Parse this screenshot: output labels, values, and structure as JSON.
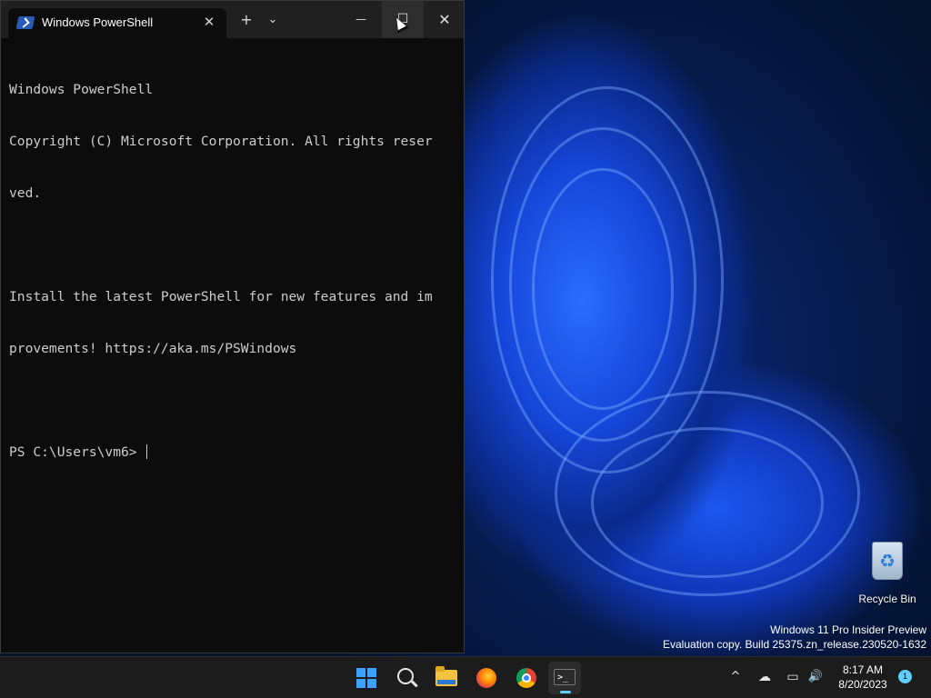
{
  "window": {
    "tab_title": "Windows PowerShell",
    "tab_close": "✕",
    "new_tab": "+",
    "dropdown": "⌄",
    "minimize": "—",
    "maximize": "☐",
    "close": "✕"
  },
  "terminal": {
    "lines": [
      "Windows PowerShell",
      "Copyright (C) Microsoft Corporation. All rights reser",
      "ved.",
      "",
      "Install the latest PowerShell for new features and im",
      "provements! https://aka.ms/PSWindows",
      ""
    ],
    "prompt": "PS C:\\Users\\vm6> "
  },
  "desktop": {
    "recycle_bin_label": "Recycle Bin",
    "watermark_line1": "Windows 11 Pro Insider Preview",
    "watermark_line2": "Evaluation copy. Build 25375.zn_release.230520-1632"
  },
  "taskbar": {
    "apps": [
      {
        "name": "start",
        "icon": "windows-logo-icon"
      },
      {
        "name": "search",
        "icon": "search-icon"
      },
      {
        "name": "file-explorer",
        "icon": "folder-icon"
      },
      {
        "name": "firefox",
        "icon": "firefox-icon"
      },
      {
        "name": "chrome",
        "icon": "chrome-icon"
      },
      {
        "name": "terminal",
        "icon": "terminal-icon",
        "active": true
      }
    ],
    "terminal_glyph": ">_",
    "tray_chevron": "^",
    "tray_cloud": "☁",
    "tray_network": "▭",
    "tray_volume": "🔊",
    "clock_time": "8:17 AM",
    "clock_date": "8/20/2023",
    "notification_count": "1"
  },
  "colors": {
    "accent": "#60cdff",
    "terminal_bg": "#0c0c0c",
    "terminal_fg": "#cccccc",
    "taskbar_bg": "#1c1c1c"
  }
}
